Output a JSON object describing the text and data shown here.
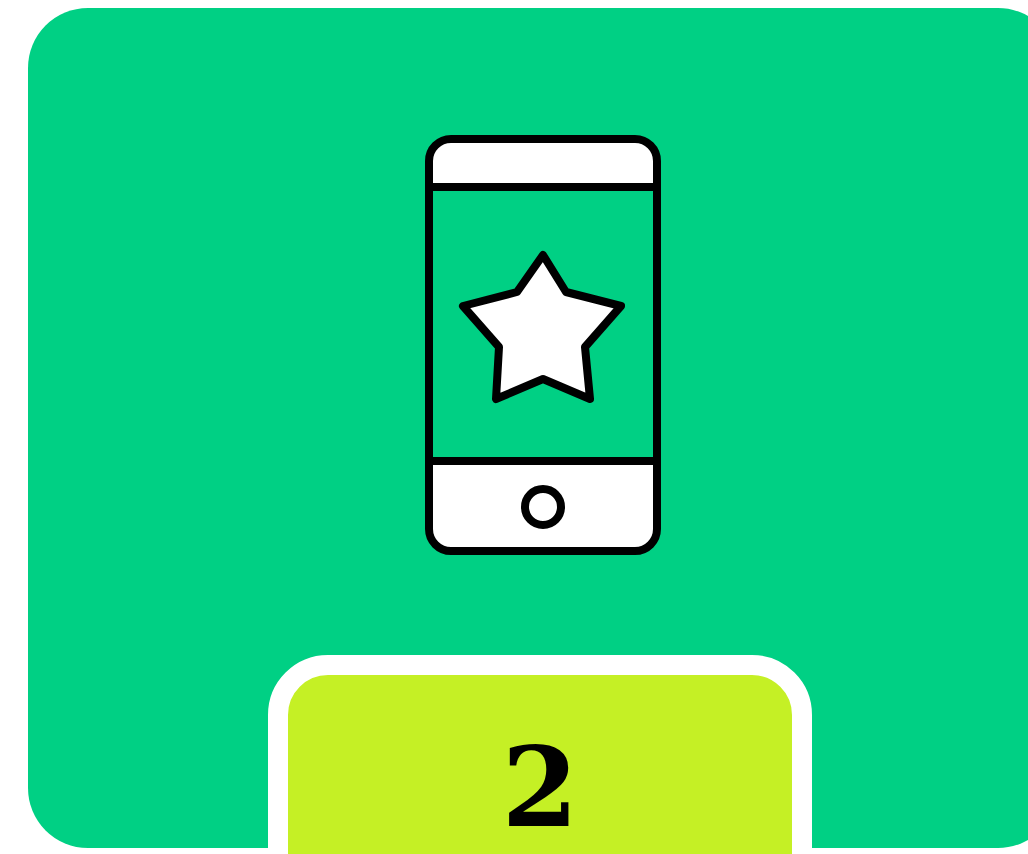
{
  "card": {
    "badge": "2"
  }
}
